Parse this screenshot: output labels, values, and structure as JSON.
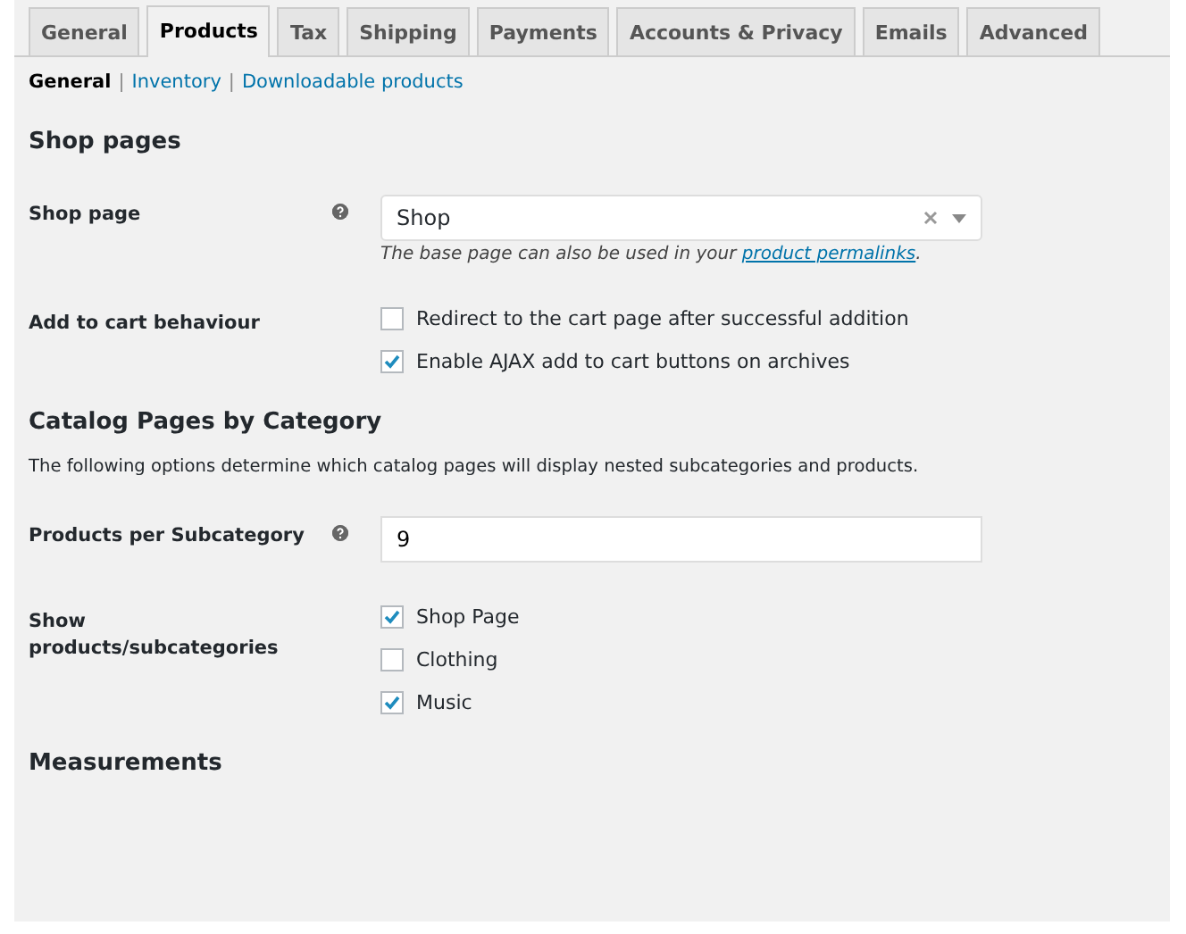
{
  "tabs": [
    {
      "label": "General",
      "selected": false
    },
    {
      "label": "Products",
      "selected": true
    },
    {
      "label": "Tax",
      "selected": false
    },
    {
      "label": "Shipping",
      "selected": false
    },
    {
      "label": "Payments",
      "selected": false
    },
    {
      "label": "Accounts & Privacy",
      "selected": false
    },
    {
      "label": "Emails",
      "selected": false
    },
    {
      "label": "Advanced",
      "selected": false
    }
  ],
  "subnav": [
    {
      "label": "General",
      "selected": true
    },
    {
      "separator": "|",
      "label": "Inventory",
      "selected": false
    },
    {
      "separator": "|",
      "label": "Downloadable products",
      "selected": false
    }
  ],
  "sections": [
    {
      "title": "Shop pages",
      "rows": [
        {
          "kind": "select",
          "label": "Shop page",
          "help": true,
          "value": "Shop",
          "description": "The base page can also be used in your ",
          "link": "product permalinks",
          "after": "."
        },
        {
          "kind": "checks",
          "label": "Add to cart behaviour",
          "options": [
            {
              "label": "Redirect to the cart page after successful addition",
              "checked": false
            },
            {
              "label": "Enable AJAX add to cart buttons on archives",
              "checked": true
            }
          ]
        }
      ]
    },
    {
      "title": "Catalog Pages by Category",
      "intro": "The following options determine which catalog pages will display nested subcategories and products.",
      "rows": [
        {
          "kind": "text",
          "label": "Products per Subcategory",
          "help": true,
          "value": "9"
        },
        {
          "kind": "checks",
          "label": "Show products/subcategories",
          "options": [
            {
              "label": "Shop Page",
              "checked": true
            },
            {
              "label": "Clothing",
              "checked": false
            },
            {
              "label": "Music",
              "checked": true
            }
          ]
        }
      ]
    },
    {
      "title": "Measurements"
    }
  ]
}
